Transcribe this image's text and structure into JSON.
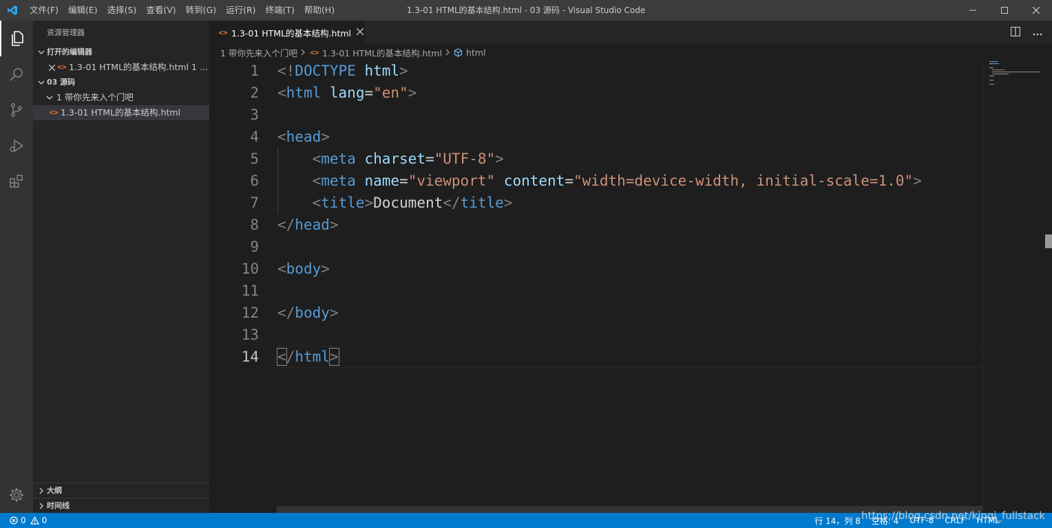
{
  "window": {
    "title": "1.3-01 HTML的基本结构.html - 03 源码 - Visual Studio Code",
    "menu": [
      "文件(F)",
      "编辑(E)",
      "选择(S)",
      "查看(V)",
      "转到(G)",
      "运行(R)",
      "终端(T)",
      "帮助(H)"
    ]
  },
  "sidebar": {
    "title": "资源管理器",
    "open_editors_header": "打开的编辑器",
    "open_editor_item": "1.3-01 HTML的基本结构.html 1 ...",
    "workspace_header": "03 源码",
    "folder": "1 带你先来入个门吧",
    "file": "1.3-01 HTML的基本结构.html",
    "outline_header": "大纲",
    "timeline_header": "时间线"
  },
  "tab": {
    "label": "1.3-01 HTML的基本结构.html"
  },
  "breadcrumbs": {
    "folder": "1 带你先来入个门吧",
    "file": "1.3-01 HTML的基本结构.html",
    "symbol": "html"
  },
  "editor": {
    "line_numbers": [
      "1",
      "2",
      "3",
      "4",
      "5",
      "6",
      "7",
      "8",
      "9",
      "10",
      "11",
      "12",
      "13",
      "14"
    ],
    "lines": [
      [
        {
          "t": "br",
          "v": "<!"
        },
        {
          "t": "tag",
          "v": "DOCTYPE"
        },
        {
          "t": "txt",
          "v": " "
        },
        {
          "t": "attr",
          "v": "html"
        },
        {
          "t": "br",
          "v": ">"
        }
      ],
      [
        {
          "t": "br",
          "v": "<"
        },
        {
          "t": "tag",
          "v": "html"
        },
        {
          "t": "txt",
          "v": " "
        },
        {
          "t": "attr",
          "v": "lang"
        },
        {
          "t": "txt",
          "v": "="
        },
        {
          "t": "str",
          "v": "\"en\""
        },
        {
          "t": "br",
          "v": ">"
        }
      ],
      [],
      [
        {
          "t": "br",
          "v": "<"
        },
        {
          "t": "tag",
          "v": "head"
        },
        {
          "t": "br",
          "v": ">"
        }
      ],
      [
        {
          "t": "txt",
          "v": "    "
        },
        {
          "t": "br",
          "v": "<"
        },
        {
          "t": "tag",
          "v": "meta"
        },
        {
          "t": "txt",
          "v": " "
        },
        {
          "t": "attr",
          "v": "charset"
        },
        {
          "t": "txt",
          "v": "="
        },
        {
          "t": "str",
          "v": "\"UTF-8\""
        },
        {
          "t": "br",
          "v": ">"
        }
      ],
      [
        {
          "t": "txt",
          "v": "    "
        },
        {
          "t": "br",
          "v": "<"
        },
        {
          "t": "tag",
          "v": "meta"
        },
        {
          "t": "txt",
          "v": " "
        },
        {
          "t": "attr",
          "v": "name"
        },
        {
          "t": "txt",
          "v": "="
        },
        {
          "t": "str",
          "v": "\"viewport\""
        },
        {
          "t": "txt",
          "v": " "
        },
        {
          "t": "attr",
          "v": "content"
        },
        {
          "t": "txt",
          "v": "="
        },
        {
          "t": "str",
          "v": "\"width=device-width, initial-scale=1.0\""
        },
        {
          "t": "br",
          "v": ">"
        }
      ],
      [
        {
          "t": "txt",
          "v": "    "
        },
        {
          "t": "br",
          "v": "<"
        },
        {
          "t": "tag",
          "v": "title"
        },
        {
          "t": "br",
          "v": ">"
        },
        {
          "t": "txt",
          "v": "Document"
        },
        {
          "t": "br",
          "v": "</"
        },
        {
          "t": "tag",
          "v": "title"
        },
        {
          "t": "br",
          "v": ">"
        }
      ],
      [
        {
          "t": "br",
          "v": "</"
        },
        {
          "t": "tag",
          "v": "head"
        },
        {
          "t": "br",
          "v": ">"
        }
      ],
      [],
      [
        {
          "t": "br",
          "v": "<"
        },
        {
          "t": "tag",
          "v": "body"
        },
        {
          "t": "br",
          "v": ">"
        }
      ],
      [],
      [
        {
          "t": "br",
          "v": "</"
        },
        {
          "t": "tag",
          "v": "body"
        },
        {
          "t": "br",
          "v": ">"
        }
      ],
      [],
      [
        {
          "t": "brm",
          "v": "<"
        },
        {
          "t": "br",
          "v": "/"
        },
        {
          "t": "tag",
          "v": "html"
        },
        {
          "t": "brm",
          "v": ">"
        }
      ]
    ]
  },
  "statusbar": {
    "errors": "0",
    "warnings": "0",
    "position": "行 14，列 8",
    "spaces": "空格: 4",
    "encoding": "UTF-8",
    "eol": "CRLF",
    "language": "HTML"
  },
  "watermark": "https://blog.csdn.net/kingi_fullstack",
  "colors": {
    "accent": "#007acc",
    "tag": "#569cd6",
    "attribute": "#9cdcfe",
    "string": "#ce9178",
    "html_icon": "#e37933"
  }
}
